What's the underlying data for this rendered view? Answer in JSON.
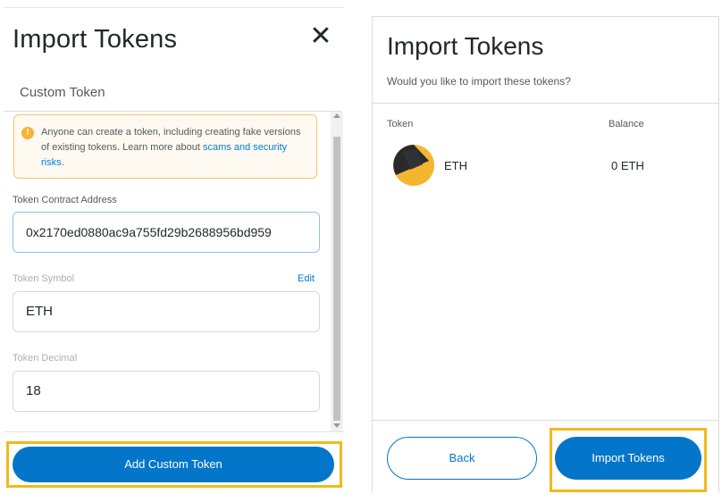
{
  "left_panel": {
    "title": "Import Tokens",
    "close_icon": "close-icon",
    "tab": "Custom Token",
    "warning": {
      "icon": "info-icon",
      "icon_glyph": "!",
      "text_before": "Anyone can create a token, including creating fake versions of existing tokens. Learn more about ",
      "link_text": "scams and security risks",
      "text_after": "."
    },
    "contract_label": "Token Contract Address",
    "contract_value": "0x2170ed0880ac9a755fd29b2688956bd959",
    "symbol_label": "Token Symbol",
    "edit_label": "Edit",
    "symbol_value": "ETH",
    "decimal_label": "Token Decimal",
    "decimal_value": "18",
    "add_button": "Add Custom Token"
  },
  "right_panel": {
    "title": "Import Tokens",
    "subtitle": "Would you like to import these tokens?",
    "col_token": "Token",
    "col_balance": "Balance",
    "tokens": [
      {
        "symbol": "ETH",
        "balance": "0 ETH",
        "icon": "eth-token-icon"
      }
    ],
    "back_button": "Back",
    "import_button": "Import Tokens"
  },
  "colors": {
    "primary": "#0376c9",
    "highlight": "#f3b81d",
    "warning_border": "#f0c66a",
    "link": "#037dd6"
  }
}
